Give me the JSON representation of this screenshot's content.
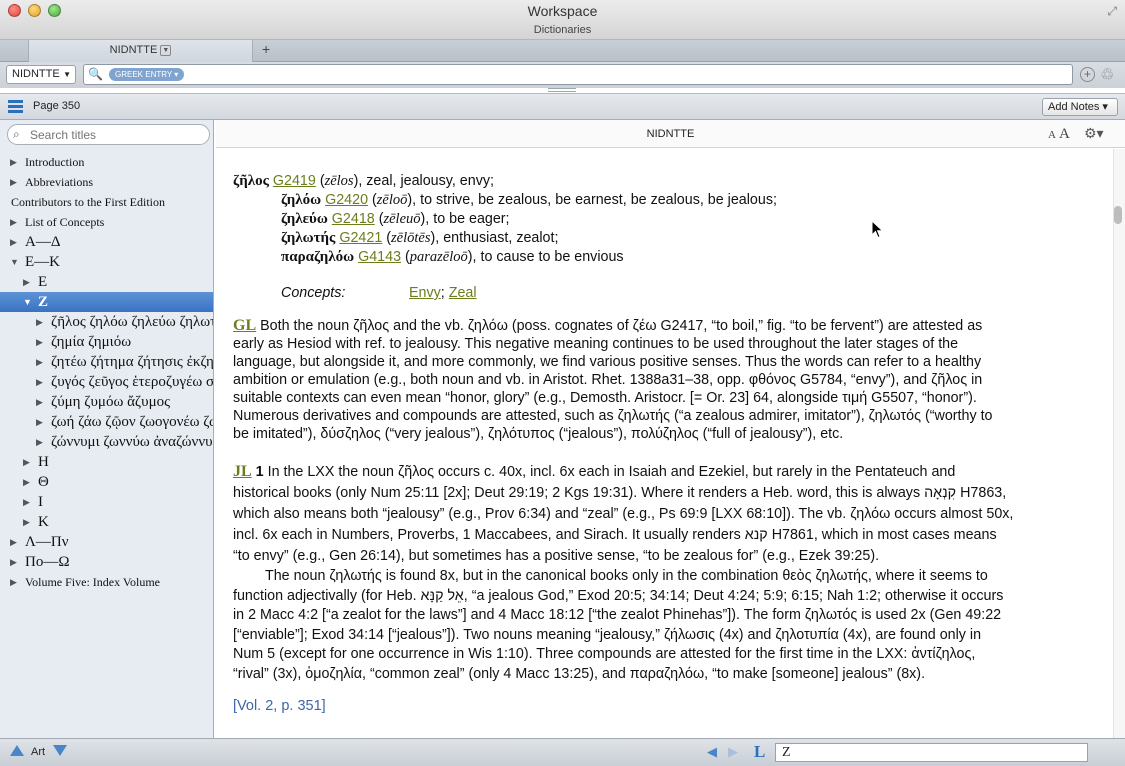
{
  "window": {
    "title": "Workspace",
    "subtitle": "Dictionaries"
  },
  "tab": {
    "label": "NIDNTTE",
    "add": "+"
  },
  "search": {
    "resource": "NIDNTTE",
    "pill": "GREEK ENTRY"
  },
  "toolbar": {
    "page": "Page 350",
    "add_notes": "Add Notes"
  },
  "sidebar": {
    "placeholder": "Search titles",
    "items": [
      {
        "label": "Introduction",
        "tri": "▶",
        "size": "small",
        "indent": 0
      },
      {
        "label": "Abbreviations",
        "tri": "▶",
        "size": "small",
        "indent": 0
      },
      {
        "label": "Contributors to the First Edition",
        "tri": "",
        "size": "small",
        "indent": 0
      },
      {
        "label": "List of Concepts",
        "tri": "▶",
        "size": "small",
        "indent": 0
      },
      {
        "label": "Α—Δ",
        "tri": "▶",
        "size": "big",
        "indent": 0
      },
      {
        "label": "Ε—Κ",
        "tri": "▼",
        "size": "big",
        "indent": 0
      },
      {
        "label": "Ε",
        "tri": "▶",
        "size": "big",
        "indent": 1
      },
      {
        "label": "Ζ",
        "tri": "▼",
        "size": "big",
        "indent": 1,
        "selected": true
      },
      {
        "label": "ζῆλος ζηλόω ζηλεύω ζηλωτής παραζηλόω",
        "tri": "▶",
        "size": "big",
        "indent": 2
      },
      {
        "label": "ζημία ζημιόω",
        "tri": "▶",
        "size": "big",
        "indent": 2
      },
      {
        "label": "ζητέω ζήτημα ζήτησις ἐκζητέω ἐπιζητέω",
        "tri": "▶",
        "size": "big",
        "indent": 2
      },
      {
        "label": "ζυγός ζεῦγος ἑτεροζυγέω σύζυγος",
        "tri": "▶",
        "size": "big",
        "indent": 2
      },
      {
        "label": "ζύμη ζυμόω ἄζυμος",
        "tri": "▶",
        "size": "big",
        "indent": 2
      },
      {
        "label": "ζωή ζάω ζῷον ζωογονέω ζωοποιέω",
        "tri": "▶",
        "size": "big",
        "indent": 2
      },
      {
        "label": "ζώννυμι ζωννύω ἀναζώννυμι διαζώννυμι",
        "tri": "▶",
        "size": "big",
        "indent": 2
      },
      {
        "label": "Η",
        "tri": "▶",
        "size": "big",
        "indent": 1
      },
      {
        "label": "Θ",
        "tri": "▶",
        "size": "big",
        "indent": 1
      },
      {
        "label": "Ι",
        "tri": "▶",
        "size": "big",
        "indent": 1
      },
      {
        "label": "Κ",
        "tri": "▶",
        "size": "big",
        "indent": 1
      },
      {
        "label": "Λ—Πν",
        "tri": "▶",
        "size": "big",
        "indent": 0
      },
      {
        "label": "Πο—Ω",
        "tri": "▶",
        "size": "big",
        "indent": 0
      },
      {
        "label": "Volume Five: Index Volume",
        "tri": "▶",
        "size": "small",
        "indent": 0
      }
    ]
  },
  "content": {
    "header": "NIDNTTE",
    "aa_small": "A",
    "aa_big": "A",
    "entries": [
      {
        "word": "ζῆλος",
        "code": "G2419",
        "translit": "zēlos",
        "gloss": ", zeal, jealousy, envy;"
      },
      {
        "word": "ζηλόω",
        "code": "G2420",
        "translit": "zēloō",
        "gloss": ", to strive, be zealous, be earnest, be zealous, be jealous;"
      },
      {
        "word": "ζηλεύω",
        "code": "G2418",
        "translit": "zēleuō",
        "gloss": ", to be eager;"
      },
      {
        "word": "ζηλωτής",
        "code": "G2421",
        "translit": "zēlōtēs",
        "gloss": ", enthusiast, zealot;"
      },
      {
        "word": "παραζηλόω",
        "code": "G4143",
        "translit": "parazēloō",
        "gloss": ", to cause to be envious"
      }
    ],
    "concepts_label": "Concepts:",
    "concepts": [
      "Envy",
      "Zeal"
    ],
    "gl_head": "GL",
    "gl_lines": [
      "Both the noun ζῆλος and the vb. ζηλόω (poss. cognates of ζέω G2417, “to boil,” fig. “to be fervent”) are attested as",
      "early as Hesiod with ref. to jealousy. This negative meaning continues to be used throughout the later stages of the",
      "language, but alongside it, and more commonly, we find various positive senses. Thus the words can refer to a healthy",
      "ambition or emulation (e.g., both noun and vb. in Aristot. Rhet. 1388a31–38, opp. φθόνος G5784, “envy”), and ζῆλος in",
      "suitable contexts can even mean “honor, glory” (e.g., Demosth. Aristocr. [= Or. 23] 64, alongside τιμή G5507, “honor”).",
      "Numerous derivatives and compounds are attested, such as ζηλωτής (“a zealous admirer, imitator”), ζηλωτός (“worthy to",
      "be imitated”), δύσζηλος (“very jealous”), ζηλότυπος (“jealous”), πολύζηλος (“full of jealousy”), etc."
    ],
    "jl_head": "JL",
    "jl_num": "1",
    "jl_lines": [
      "In the LXX the noun ζῆλος occurs c. 40x, incl. 6x each in Isaiah and Ezekiel, but rarely in the Pentateuch and",
      "historical books (only Num 25:11 [2x]; Deut 29:19; 2 Kgs 19:31). Where it renders a Heb. word, this is always קִנְאָה H7863,",
      "which also means both “jealousy” (e.g., Prov 6:34) and “zeal” (e.g., Ps 69:9 [LXX 68:10]). The vb. ζηλόω occurs almost 50x,",
      "incl. 6x each in Numbers, Proverbs, 1 Maccabees, and Sirach. It usually renders קנא H7861, which in most cases means",
      "“to envy” (e.g., Gen 26:14), but sometimes has a positive sense, “to be zealous for” (e.g., Ezek 39:25)."
    ],
    "jl_para2": [
      "The noun ζηλωτής is found 8x, but in the canonical books only in the combination θεὸς ζηλωτής, where it seems to",
      "function adjectivally (for Heb. אֵל קַנָּא, “a jealous God,” Exod 20:5; 34:14; Deut 4:24; 5:9; 6:15; Nah 1:2; otherwise it occurs",
      "in 2 Macc 4:2 [“a zealot for the laws”] and 4 Macc 18:12 [“the zealot Phinehas”]). The form ζηλωτός is used 2x (Gen 49:22",
      "[“enviable”]; Exod 34:14 [“jealous”]). Two nouns meaning “jealousy,” ζήλωσις (4x) and ζηλοτυπία (4x), are found only in",
      "Num 5 (except for one occurrence in Wis 1:10). Three compounds are attested for the first time in the LXX: ἀντίζηλος,",
      "“rival” (3x), ὁμοζηλία, “common zeal” (only 4 Macc 13:25), and παραζηλόω, “to make [someone] jealous” (8x)."
    ],
    "vol_ref": "[Vol. 2, p. 351]"
  },
  "bottom": {
    "art": "Art",
    "goto_value": "Z",
    "link": "L"
  },
  "colors": {
    "link": "#6b7e1c",
    "accent": "#3a72c1",
    "vol": "#3b66a8"
  }
}
